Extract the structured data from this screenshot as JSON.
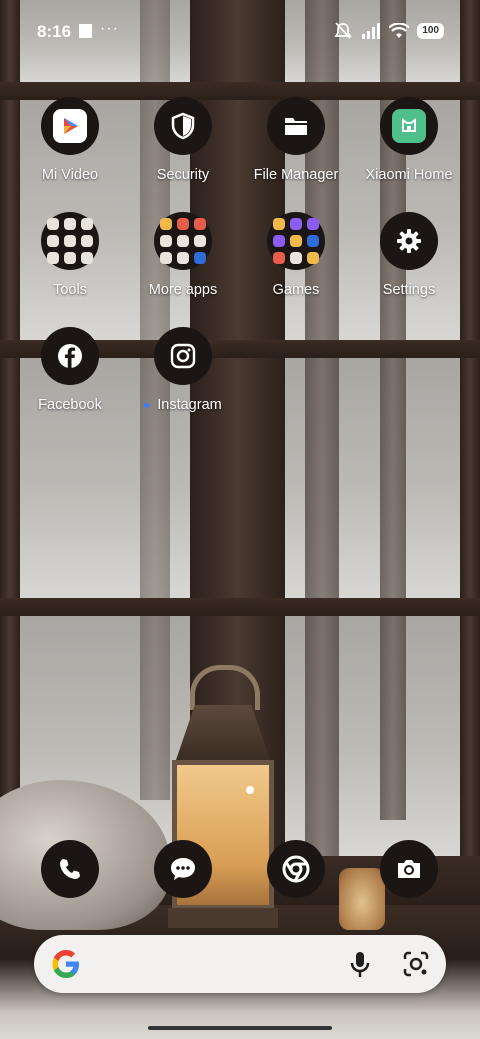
{
  "status_bar": {
    "time": "8:16",
    "battery": "100",
    "icons": [
      "notification-square",
      "more-dots",
      "mute-icon",
      "signal-icon",
      "wifi-icon",
      "battery-icon"
    ]
  },
  "apps": [
    {
      "label": "Mi Video",
      "icon": "mi-video-icon"
    },
    {
      "label": "Security",
      "icon": "security-shield-icon"
    },
    {
      "label": "File Manager",
      "icon": "folder-icon"
    },
    {
      "label": "Xiaomi Home",
      "icon": "xiaomi-home-icon"
    },
    {
      "label": "Tools",
      "icon": "tools-folder-icon"
    },
    {
      "label": "More apps",
      "icon": "more-apps-folder-icon"
    },
    {
      "label": "Games",
      "icon": "games-folder-icon"
    },
    {
      "label": "Settings",
      "icon": "gear-icon"
    },
    {
      "label": "Facebook",
      "icon": "facebook-icon"
    },
    {
      "label": "Instagram",
      "icon": "instagram-icon"
    }
  ],
  "dock": [
    {
      "icon": "phone-icon"
    },
    {
      "icon": "messages-icon"
    },
    {
      "icon": "chrome-icon"
    },
    {
      "icon": "camera-icon"
    }
  ],
  "search_bar": {
    "icons": [
      "google-g-icon",
      "microphone-icon",
      "google-lens-icon"
    ]
  },
  "colors": {
    "icon_bg": "#1b1513",
    "label_text": "#ffffff",
    "search_bg": "#f2f1ef",
    "new_dot": "#3d7bff"
  }
}
